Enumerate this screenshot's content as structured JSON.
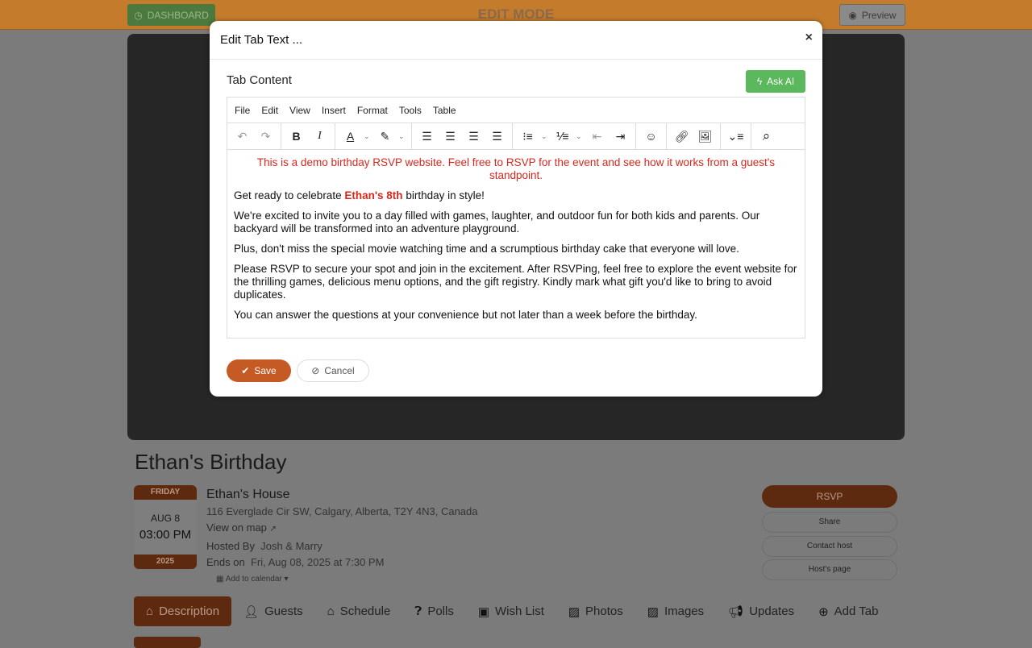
{
  "header": {
    "dashboard": "DASHBOARD",
    "mode": "EDIT MODE",
    "preview": "Preview"
  },
  "event": {
    "title": "Ethan's Birthday",
    "weekday": "FRIDAY",
    "month_day": "AUG 8",
    "time": "03:00 PM",
    "year": "2025",
    "venue": "Ethan's House",
    "address": "116 Everglade Cir SW, Calgary, Alberta, T2Y 4N3, Canada",
    "map_link": "View on map",
    "hosted_label": "Hosted By",
    "hosts": "Josh & Marry",
    "ends_label": "Ends on",
    "ends": "Fri, Aug 08, 2025 at 7:30 PM",
    "add_calendar": "Add to calendar"
  },
  "actions": {
    "rsvp": "RSVP",
    "share": "Share",
    "contact": "Contact host",
    "hosts_page": "Host's page"
  },
  "tabs": [
    {
      "label": "Description",
      "icon": "home-icon"
    },
    {
      "label": "Guests",
      "icon": "user-icon"
    },
    {
      "label": "Schedule",
      "icon": "home-icon"
    },
    {
      "label": "Polls",
      "icon": "question-icon"
    },
    {
      "label": "Wish List",
      "icon": "gift-icon"
    },
    {
      "label": "Photos",
      "icon": "image-icon"
    },
    {
      "label": "Images",
      "icon": "image-icon"
    },
    {
      "label": "Updates",
      "icon": "bullhorn-icon"
    },
    {
      "label": "Add Tab",
      "icon": "plus-circle-icon"
    }
  ],
  "modal": {
    "title": "Edit Tab Text ...",
    "close": "×",
    "label": "Tab Content",
    "ask_ai": "Ask AI",
    "save": "Save",
    "cancel": "Cancel",
    "menu": [
      "File",
      "Edit",
      "View",
      "Insert",
      "Format",
      "Tools",
      "Table"
    ],
    "content": {
      "notice": "This is a demo birthday RSVP website. Feel free to RSVP for the event and see how it works from a guest's standpoint.",
      "p1_pre": "Get ready to celebrate ",
      "p1_bold": "Ethan's 8th",
      "p1_post": " birthday in style!",
      "p2": "We're excited to invite you to a day filled with games, laughter, and outdoor fun for both kids and parents. Our backyard will be transformed into an adventure playground.",
      "p3": "Plus, don't miss the special movie watching time and a scrumptious birthday cake that everyone will love.",
      "p4": "Please RSVP to secure your spot and join in the excitement. After RSVPing, feel free to explore the event website for the thrilling games, delicious menu options, and the gift registry. Kindly mark what gift you'd like to bring to avoid duplicates.",
      "p5": "You can answer the questions at your convenience but not later than a week before the birthday."
    }
  },
  "colors": {
    "accent": "#c55a24",
    "ai": "#5cb85c",
    "notice": "#d6281e"
  }
}
